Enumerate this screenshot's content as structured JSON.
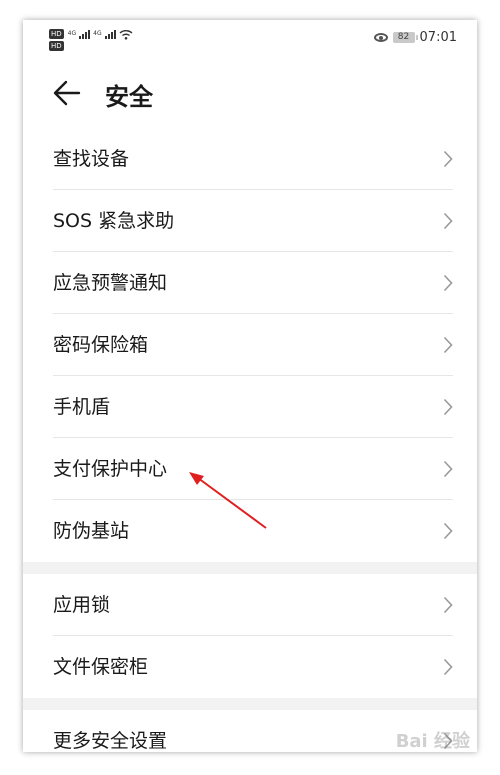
{
  "status_bar": {
    "hd_label": "HD",
    "net_1": "4G",
    "net_2": "4G",
    "battery": "82",
    "time": "07:01"
  },
  "header": {
    "title": "安全"
  },
  "groups": [
    {
      "items": [
        {
          "label": "查找设备"
        },
        {
          "label": "SOS 紧急求助"
        },
        {
          "label": "应急预警通知"
        },
        {
          "label": "密码保险箱"
        },
        {
          "label": "手机盾"
        },
        {
          "label": "支付保护中心"
        },
        {
          "label": "防伪基站"
        }
      ]
    },
    {
      "items": [
        {
          "label": "应用锁"
        },
        {
          "label": "文件保密柜"
        }
      ]
    },
    {
      "items": [
        {
          "label": "更多安全设置"
        }
      ]
    }
  ],
  "annotation": {
    "color": "#e02020"
  },
  "watermark": "Bai 经验"
}
